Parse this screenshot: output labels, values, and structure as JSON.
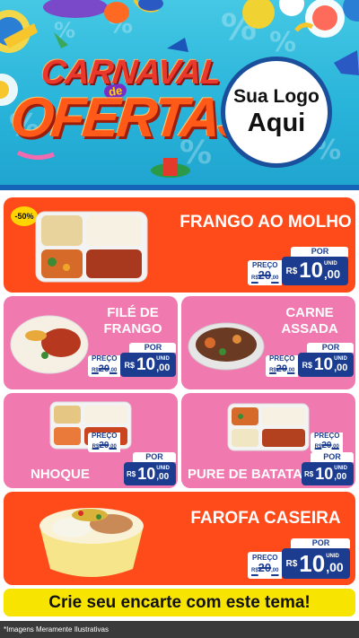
{
  "banner": {
    "title_line1": "CARNAVAL",
    "title_connector": "de",
    "title_line2": "OFERTAS",
    "logo_line1": "Sua Logo",
    "logo_line2": "Aqui"
  },
  "colors": {
    "orange_card": "#ff4a1a",
    "pink_card": "#f07ab0",
    "price_blue": "#1c3d8f",
    "cta_yellow": "#f7e400",
    "banner_blue": "#29b4da"
  },
  "price_labels": {
    "old_label": "PREÇO",
    "new_label": "POR",
    "currency": "R$",
    "unit": "UNID"
  },
  "products": [
    {
      "name_lines": [
        "FRANGO AO MOLHO"
      ],
      "badge": "-50%",
      "old_int": "20",
      "old_dec": ",00",
      "new_int": "10",
      "new_dec": ",00",
      "old_prefix": "R$"
    },
    {
      "name_lines": [
        "FILÉ DE",
        "FRANGO"
      ],
      "old_int": "20",
      "old_dec": ",00",
      "new_int": "10",
      "new_dec": ",00",
      "old_prefix": "R$"
    },
    {
      "name_lines": [
        "CARNE",
        "ASSADA"
      ],
      "old_int": "20",
      "old_dec": ",00",
      "new_int": "10",
      "new_dec": ",00",
      "old_prefix": "R$"
    },
    {
      "name_lines": [
        "NHOQUE"
      ],
      "old_int": "20",
      "old_dec": ",00",
      "new_int": "10",
      "new_dec": ",00",
      "old_prefix": "R$"
    },
    {
      "name_lines": [
        "PURE DE BATATA"
      ],
      "old_int": "20",
      "old_dec": ",00",
      "new_int": "10",
      "new_dec": ",00",
      "old_prefix": "R$"
    },
    {
      "name_lines": [
        "FAROFA CASEIRA"
      ],
      "old_int": "20",
      "old_dec": ",00",
      "new_int": "10",
      "new_dec": ",00",
      "old_prefix": "R$"
    }
  ],
  "cta": "Crie seu encarte com este tema!",
  "footer": "*Imagens Meramente Ilustrativas"
}
